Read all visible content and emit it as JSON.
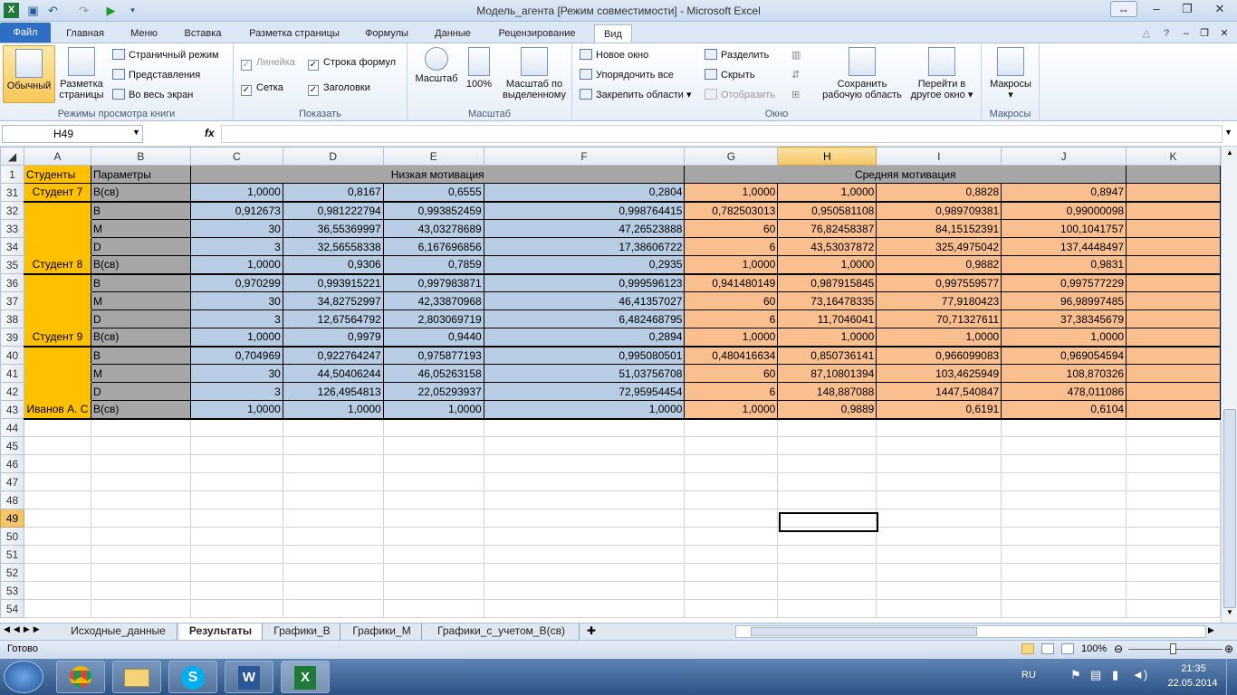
{
  "window": {
    "title": "Модель_агента  [Режим совместимости]  -  Microsoft Excel"
  },
  "tabs": [
    "Файл",
    "Главная",
    "Меню",
    "Вставка",
    "Разметка страницы",
    "Формулы",
    "Данные",
    "Рецензирование",
    "Вид"
  ],
  "ribbon": {
    "views": {
      "normal": "Обычный",
      "page_layout_1": "Разметка",
      "page_layout_2": "страницы",
      "page_break": "Страничный режим",
      "custom": "Представления",
      "fullscreen": "Во весь экран",
      "label": "Режимы просмотра книги"
    },
    "show": {
      "ruler": "Линейка",
      "formula_bar": "Строка формул",
      "gridlines": "Сетка",
      "headings": "Заголовки",
      "label": "Показать"
    },
    "zoom": {
      "zoom": "Масштаб",
      "zoom100": "100%",
      "zoomsel_1": "Масштаб по",
      "zoomsel_2": "выделенному",
      "label": "Масштаб"
    },
    "window": {
      "new": "Новое окно",
      "arrange": "Упорядочить все",
      "freeze": "Закрепить области",
      "split": "Разделить",
      "hide": "Скрыть",
      "unhide": "Отобразить",
      "save_ws_1": "Сохранить",
      "save_ws_2": "рабочую область",
      "switch_1": "Перейти в",
      "switch_2": "другое окно",
      "label": "Окно"
    },
    "macros": {
      "macros": "Макросы",
      "label": "Макросы"
    }
  },
  "formula_bar": {
    "namebox": "H49",
    "fx": "fx"
  },
  "columns": [
    "A",
    "B",
    "C",
    "D",
    "E",
    "F",
    "G",
    "H",
    "I",
    "J",
    "K"
  ],
  "header_row": {
    "row": "1",
    "a": "Студенты",
    "b": "Параметры",
    "low": "Низкая мотивация",
    "mid": "Средняя мотивация"
  },
  "rows": [
    {
      "n": "31",
      "a": "Студент 7",
      "b": "B(св)",
      "c": [
        "1,0000",
        "0,8167",
        "0,6555",
        "0,2804"
      ],
      "g": [
        "1,0000",
        "1,0000",
        "0,8828",
        "0,8947"
      ]
    },
    {
      "n": "32",
      "a": "",
      "b": "B",
      "c": [
        "0,912673",
        "0,981222794",
        "0,993852459",
        "0,998764415"
      ],
      "g": [
        "0,782503013",
        "0,950581108",
        "0,989709381",
        "0,99000098"
      ]
    },
    {
      "n": "33",
      "a": "",
      "b": "M",
      "c": [
        "30",
        "36,55369997",
        "43,03278689",
        "47,26523888"
      ],
      "g": [
        "60",
        "76,82458387",
        "84,15152391",
        "100,1041757"
      ]
    },
    {
      "n": "34",
      "a": "",
      "b": "D",
      "c": [
        "3",
        "32,56558338",
        "6,167696856",
        "17,38606722"
      ],
      "g": [
        "6",
        "43,53037872",
        "325,4975042",
        "137,4448497"
      ]
    },
    {
      "n": "35",
      "a": "Студент 8",
      "b": "B(св)",
      "c": [
        "1,0000",
        "0,9306",
        "0,7859",
        "0,2935"
      ],
      "g": [
        "1,0000",
        "1,0000",
        "0,9882",
        "0,9831"
      ]
    },
    {
      "n": "36",
      "a": "",
      "b": "B",
      "c": [
        "0,970299",
        "0,993915221",
        "0,997983871",
        "0,999596123"
      ],
      "g": [
        "0,941480149",
        "0,987915845",
        "0,997559577",
        "0,997577229"
      ]
    },
    {
      "n": "37",
      "a": "",
      "b": "M",
      "c": [
        "30",
        "34,82752997",
        "42,33870968",
        "46,41357027"
      ],
      "g": [
        "60",
        "73,16478335",
        "77,9180423",
        "96,98997485"
      ]
    },
    {
      "n": "38",
      "a": "",
      "b": "D",
      "c": [
        "3",
        "12,67564792",
        "2,803069719",
        "6,482468795"
      ],
      "g": [
        "6",
        "11,7046041",
        "70,71327611",
        "37,38345679"
      ]
    },
    {
      "n": "39",
      "a": "Студент 9",
      "b": "B(св)",
      "c": [
        "1,0000",
        "0,9979",
        "0,9440",
        "0,2894"
      ],
      "g": [
        "1,0000",
        "1,0000",
        "1,0000",
        "1,0000"
      ]
    },
    {
      "n": "40",
      "a": "",
      "b": "B",
      "c": [
        "0,704969",
        "0,922764247",
        "0,975877193",
        "0,995080501"
      ],
      "g": [
        "0,480416634",
        "0,850736141",
        "0,966099083",
        "0,969054594"
      ]
    },
    {
      "n": "41",
      "a": "",
      "b": "M",
      "c": [
        "30",
        "44,50406244",
        "46,05263158",
        "51,03756708"
      ],
      "g": [
        "60",
        "87,10801394",
        "103,4625949",
        "108,870326"
      ]
    },
    {
      "n": "42",
      "a": "",
      "b": "D",
      "c": [
        "3",
        "126,4954813",
        "22,05293937",
        "72,95954454"
      ],
      "g": [
        "6",
        "148,887088",
        "1447,540847",
        "478,011086"
      ]
    },
    {
      "n": "43",
      "a": "Иванов А. С",
      "b": "B(св)",
      "c": [
        "1,0000",
        "1,0000",
        "1,0000",
        "1,0000"
      ],
      "g": [
        "1,0000",
        "0,9889",
        "0,6191",
        "0,6104"
      ]
    }
  ],
  "empty_rows": [
    "44",
    "45",
    "46",
    "47",
    "48",
    "49",
    "50",
    "51",
    "52",
    "53",
    "54"
  ],
  "sheets": [
    "Исходные_данные",
    "Результаты",
    "Графики_В",
    "Графики_М",
    "Графики_с_учетом_В(св)"
  ],
  "status": {
    "ready": "Готово",
    "zoom": "100%"
  },
  "taskbar": {
    "lang": "RU",
    "time": "21:35",
    "date": "22.05.2014"
  }
}
